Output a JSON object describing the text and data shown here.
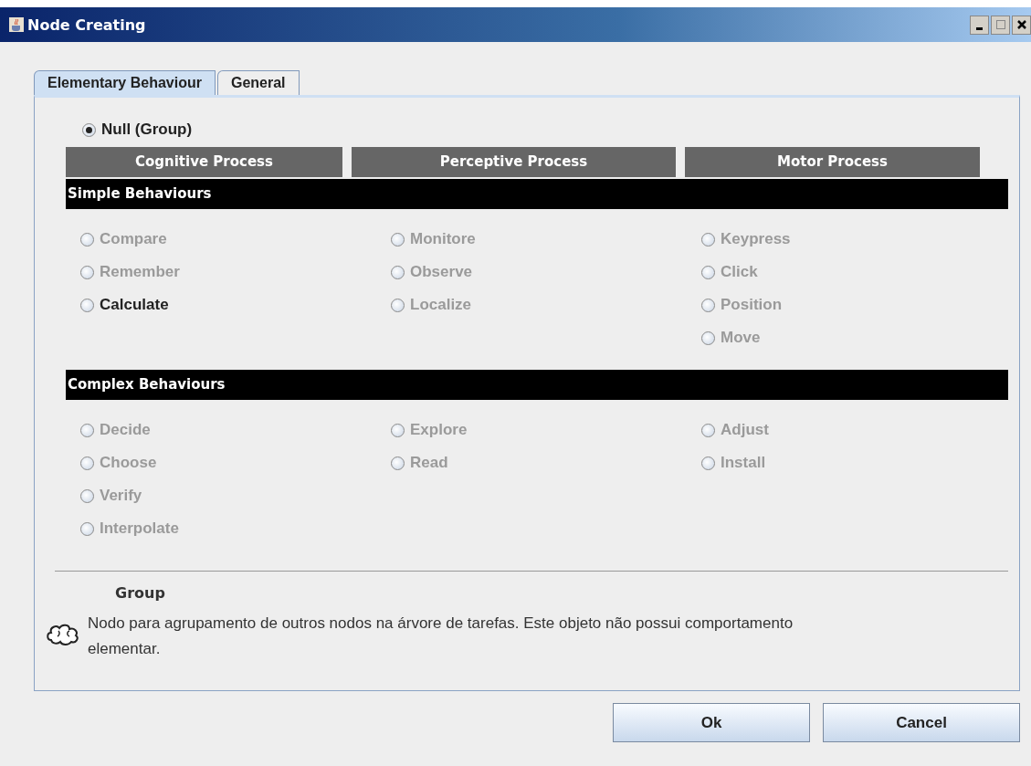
{
  "window": {
    "title": "Node Creating"
  },
  "tabs": [
    {
      "label": "Elementary Behaviour",
      "selected": true
    },
    {
      "label": "General",
      "selected": false
    }
  ],
  "null_option": {
    "label": "Null (Group)",
    "selected": true,
    "disabled": false
  },
  "columns": [
    "Cognitive Process",
    "Perceptive Process",
    "Motor Process"
  ],
  "sections": [
    {
      "title": "Simple Behaviours",
      "columns": [
        [
          {
            "label": "Compare",
            "selected": false,
            "disabled": true
          },
          {
            "label": "Remember",
            "selected": false,
            "disabled": true
          },
          {
            "label": "Calculate",
            "selected": false,
            "disabled": false
          }
        ],
        [
          {
            "label": "Monitore",
            "selected": false,
            "disabled": true
          },
          {
            "label": "Observe",
            "selected": false,
            "disabled": true
          },
          {
            "label": "Localize",
            "selected": false,
            "disabled": true
          }
        ],
        [
          {
            "label": "Keypress",
            "selected": false,
            "disabled": true
          },
          {
            "label": "Click",
            "selected": false,
            "disabled": true
          },
          {
            "label": "Position",
            "selected": false,
            "disabled": true
          },
          {
            "label": "Move",
            "selected": false,
            "disabled": true
          }
        ]
      ]
    },
    {
      "title": "Complex Behaviours",
      "columns": [
        [
          {
            "label": "Decide",
            "selected": false,
            "disabled": true
          },
          {
            "label": "Choose",
            "selected": false,
            "disabled": true
          },
          {
            "label": "Verify",
            "selected": false,
            "disabled": true
          },
          {
            "label": "Interpolate",
            "selected": false,
            "disabled": true
          }
        ],
        [
          {
            "label": "Explore",
            "selected": false,
            "disabled": true
          },
          {
            "label": "Read",
            "selected": false,
            "disabled": true
          }
        ],
        [
          {
            "label": "Adjust",
            "selected": false,
            "disabled": true
          },
          {
            "label": "Install",
            "selected": false,
            "disabled": true
          }
        ]
      ]
    }
  ],
  "description": {
    "title": "Group",
    "text": "Nodo para agrupamento de outros nodos na árvore de tarefas. Este objeto não possui comportamento elementar."
  },
  "buttons": [
    "Ok",
    "Cancel"
  ]
}
